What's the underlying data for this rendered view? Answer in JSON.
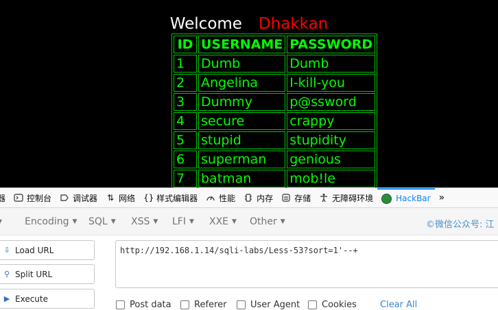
{
  "page": {
    "welcome_text": "Welcome",
    "user_name": "Dhakkan",
    "table": {
      "headers": [
        "ID",
        "USERNAME",
        "PASSWORD"
      ],
      "rows": [
        [
          "1",
          "Dumb",
          "Dumb"
        ],
        [
          "2",
          "Angelina",
          "I-kill-you"
        ],
        [
          "3",
          "Dummy",
          "p@ssword"
        ],
        [
          "4",
          "secure",
          "crappy"
        ],
        [
          "5",
          "stupid",
          "stupidity"
        ],
        [
          "6",
          "superman",
          "genious"
        ],
        [
          "7",
          "batman",
          "mob!le"
        ]
      ]
    }
  },
  "devtools": {
    "tools": [
      {
        "label": "器",
        "icon": "inspector-icon"
      },
      {
        "label": "控制台",
        "icon": "console-icon"
      },
      {
        "label": "调试器",
        "icon": "debugger-icon"
      },
      {
        "label": "网络",
        "icon": "network-icon"
      },
      {
        "label": "样式编辑器",
        "icon": "style-editor-icon"
      },
      {
        "label": "性能",
        "icon": "performance-icon"
      },
      {
        "label": "内存",
        "icon": "memory-icon"
      },
      {
        "label": "存储",
        "icon": "storage-icon"
      },
      {
        "label": "无障碍环境",
        "icon": "accessibility-icon"
      },
      {
        "label": "HackBar",
        "icon": "hackbar-icon"
      }
    ],
    "more_label": "»"
  },
  "hackbar": {
    "menu": [
      "Encoding",
      "SQL",
      "XSS",
      "LFI",
      "XXE",
      "Other"
    ],
    "wechat": "©微信公众号: 江",
    "buttons": {
      "load": "Load URL",
      "split": "Split URL",
      "execute": "Execute"
    },
    "url": "http://192.168.1.14/sqli-labs/Less-53?sort=1'--+",
    "options": [
      "Post data",
      "Referer",
      "User Agent",
      "Cookies"
    ],
    "clear_all": "Clear All"
  }
}
